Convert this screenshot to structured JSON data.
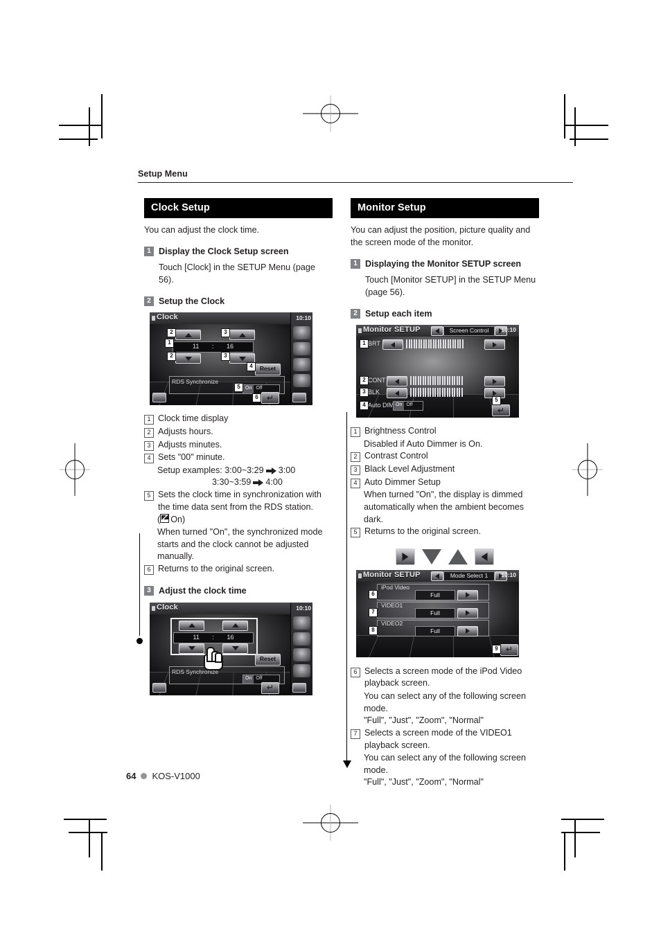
{
  "running_head": "Setup Menu",
  "footer": {
    "page_number": "64",
    "model": "KOS-V1000",
    "dot_icon": "bullet-dot"
  },
  "left_column": {
    "section_title": "Clock Setup",
    "intro": "You can adjust the clock time.",
    "steps": [
      {
        "num": "1",
        "title": "Display the Clock Setup screen",
        "body": "Touch [Clock] in the SETUP Menu (page 56)."
      },
      {
        "num": "2",
        "title": "Setup the Clock"
      },
      {
        "num": "3",
        "title": "Adjust the clock time"
      }
    ],
    "callouts": [
      {
        "num": "1",
        "text": "Clock time display"
      },
      {
        "num": "2",
        "text": "Adjusts hours."
      },
      {
        "num": "3",
        "text": "Adjusts minutes."
      },
      {
        "num": "4",
        "text": "Sets \"00\" minute.",
        "sub1": "Setup examples: 3:00~3:29",
        "sub1b": "3:00",
        "sub2": "3:30~3:59",
        "sub2b": "4:00"
      },
      {
        "num": "5",
        "text": "Sets the clock time in synchronization with the time data sent from the RDS station.",
        "on_label": "On",
        "sub": "When turned \"On\", the synchronized mode starts and the clock cannot be adjusted manually."
      },
      {
        "num": "6",
        "text": "Returns to the original screen."
      }
    ],
    "screen_clock": {
      "title": "Clock",
      "clock_display": "10:10",
      "hours": "11",
      "separator": ":",
      "minutes": "16",
      "reset_label": "Reset",
      "rds_label": "RDS Synchronize",
      "toggle_on": "On",
      "toggle_off": "Off",
      "tags": [
        "1",
        "2",
        "3",
        "4",
        "5",
        "6"
      ]
    },
    "screen_clock_adjust": {
      "title": "Clock",
      "clock_display": "10:10",
      "hours": "11",
      "separator": ":",
      "minutes": "16",
      "reset_label": "Reset",
      "rds_label": "RDS Synchronize",
      "toggle_on": "On",
      "toggle_off": "Off"
    }
  },
  "right_column": {
    "section_title": "Monitor Setup",
    "intro": "You can adjust the position, picture quality and the screen mode of the monitor.",
    "steps": [
      {
        "num": "1",
        "title": "Displaying the Monitor SETUP screen",
        "body": "Touch [Monitor SETUP] in the SETUP Menu (page 56)."
      },
      {
        "num": "2",
        "title": "Setup each item"
      }
    ],
    "callouts_top": [
      {
        "num": "1",
        "text": "Brightness Control",
        "sub": "Disabled if Auto Dimmer is On."
      },
      {
        "num": "2",
        "text": "Contrast Control"
      },
      {
        "num": "3",
        "text": "Black Level Adjustment"
      },
      {
        "num": "4",
        "text": "Auto Dimmer Setup",
        "sub": "When turned \"On\", the display is dimmed automatically when the ambient becomes dark."
      },
      {
        "num": "5",
        "text": "Returns to the original screen."
      }
    ],
    "callouts_bottom": [
      {
        "num": "6",
        "text": "Selects a screen mode of the iPod Video playback screen.",
        "sub": "You can select any of the following screen mode.",
        "modes": "\"Full\", \"Just\", \"Zoom\", \"Normal\""
      },
      {
        "num": "7",
        "text": "Selects a screen mode of the VIDEO1 playback screen.",
        "sub": "You can select any of the following screen mode.",
        "modes": "\"Full\", \"Just\", \"Zoom\", \"Normal\""
      }
    ],
    "screen_monitor_1": {
      "title": "Monitor SETUP",
      "mode_label": "Screen Control",
      "clock_display": "10:10",
      "rows": [
        {
          "num": "1",
          "label": "BRT"
        },
        {
          "num": "2",
          "label": "CONT"
        },
        {
          "num": "3",
          "label": "BLK"
        }
      ],
      "dim_num": "4",
      "dim_label": "Auto DIM",
      "toggle_on": "On",
      "toggle_off": "Off",
      "return_num": "5"
    },
    "screen_monitor_2": {
      "title": "Monitor SETUP",
      "mode_label": "Mode Select 1",
      "clock_display": "10:10",
      "rows": [
        {
          "num": "6",
          "label": "iPod Video",
          "value": "Full"
        },
        {
          "num": "7",
          "label": "VIDEO1",
          "value": "Full"
        },
        {
          "num": "8",
          "label": "VIDEO2",
          "value": "Full"
        }
      ],
      "return_num": "9"
    },
    "nav_glyphs": [
      "play-right-button",
      "triangle-down",
      "triangle-up",
      "play-left-button"
    ]
  }
}
